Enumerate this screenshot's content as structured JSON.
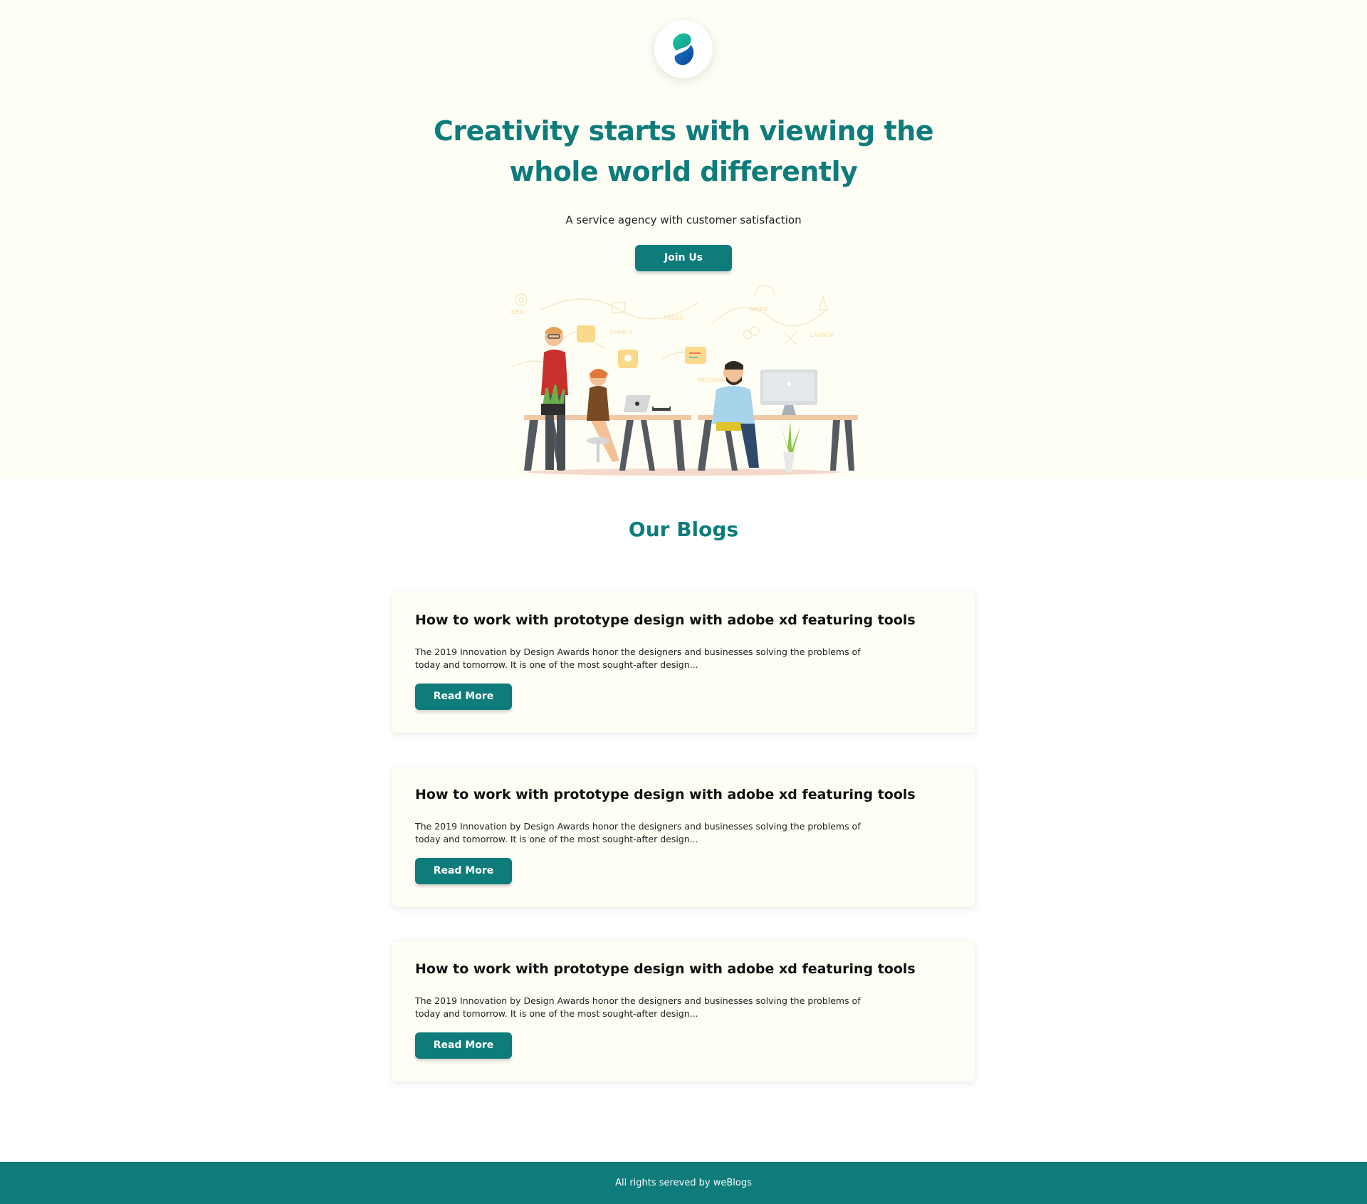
{
  "hero": {
    "title_line1": "Creativity starts with viewing the",
    "title_line2": "whole world differently",
    "subtitle": "A service agency with customer satisfaction",
    "join_label": "Join Us"
  },
  "blogs": {
    "title": "Our Blogs",
    "items": [
      {
        "title": "How to work with prototype design with adobe xd featuring tools",
        "excerpt": "The 2019 Innovation by Design Awards honor the designers and businesses solving the problems of today and tomorrow. It is one of the most sought-after design...",
        "button_label": "Read More"
      },
      {
        "title": "How to work with prototype design with adobe xd featuring tools",
        "excerpt": "The 2019 Innovation by Design Awards honor the designers and businesses solving the problems of today and tomorrow. It is one of the most sought-after design...",
        "button_label": "Read More"
      },
      {
        "title": "How to work with prototype design with adobe xd featuring tools",
        "excerpt": "The 2019 Innovation by Design Awards honor the designers and businesses solving the problems of today and tomorrow. It is one of the most sought-after design...",
        "button_label": "Read More"
      }
    ]
  },
  "illustration": {
    "labels": [
      "IDEA",
      "FOCUS",
      "PROGRAMMING",
      "LAUNCH",
      "SPEED",
      "SEARCH"
    ]
  },
  "footer": {
    "text": "All rights sereved by weBlogs"
  },
  "colors": {
    "primary": "#0e7c7b",
    "hero_bg": "#fefef5",
    "card_bg": "#fefef5"
  }
}
